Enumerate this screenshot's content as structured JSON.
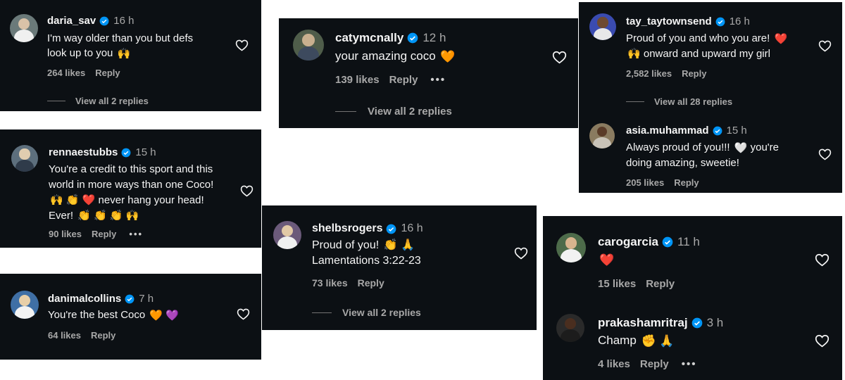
{
  "colors": {
    "card_bg": "#0c1014",
    "verified": "#0095f6",
    "muted": "#a8a8a8",
    "heart_red": "#ff3040",
    "heart_orange": "#ff7a45",
    "heart_purple": "#a855f7",
    "heart_lilac": "#d8c8f5"
  },
  "comments": [
    {
      "user": "daria_sav",
      "time": "16 h",
      "lines": [
        "I'm way older than you but defs",
        "look up to you"
      ],
      "line_emojis": [
        "",
        "🙌"
      ],
      "likes": "264 likes",
      "reply": "Reply",
      "view_replies": "View all 2 replies"
    },
    {
      "user": "catymcnally",
      "time": "12 h",
      "lines": [
        "your amazing coco"
      ],
      "line_emojis": [
        "🧡"
      ],
      "likes": "139 likes",
      "reply": "Reply",
      "more": "•••",
      "view_replies": "View all 2 replies"
    },
    {
      "user": "tay_taytownsend",
      "time": "16 h",
      "lines": [
        "Proud of you and who you are!",
        "onward and upward my girl"
      ],
      "line_emojis": [
        "❤️",
        "🙌"
      ],
      "likes": "2,582 likes",
      "reply": "Reply",
      "view_replies": "View all 28 replies"
    },
    {
      "user": "asia.muhammad",
      "time": "15 h",
      "lines": [
        "Always proud of you!!!",
        "doing amazing, sweetie!"
      ],
      "mid_emoji": "🤍",
      "mid_text": "you're",
      "likes": "205 likes",
      "reply": "Reply"
    },
    {
      "user": "rennaestubbs",
      "time": "15 h",
      "lines": [
        "You're a credit to this sport and this",
        "world in more ways than one Coco!",
        "never hang your head!",
        "Ever!"
      ],
      "line3_emojis": "🙌 👏 ❤️",
      "line4_emojis": "👏 👏 👏 🙌",
      "likes": "90 likes",
      "reply": "Reply",
      "more": "•••"
    },
    {
      "user": "shelbsrogers",
      "time": "16 h",
      "lines": [
        "Proud of you!",
        "Lamentations 3:22-23"
      ],
      "line_emojis": [
        "👏 🙏",
        ""
      ],
      "likes": "73 likes",
      "reply": "Reply",
      "view_replies": "View all 2 replies"
    },
    {
      "user": "carogarcia",
      "time": "11 h",
      "lines": [
        "❤️"
      ],
      "likes": "15 likes",
      "reply": "Reply"
    },
    {
      "user": "danimalcollins",
      "time": "7 h",
      "lines": [
        "You're the best Coco"
      ],
      "line_emojis": [
        "🧡 💜"
      ],
      "likes": "64 likes",
      "reply": "Reply"
    },
    {
      "user": "prakashamritraj",
      "time": "3 h",
      "lines": [
        "Champ"
      ],
      "line_emojis": [
        "✊ 🙏"
      ],
      "likes": "4 likes",
      "reply": "Reply",
      "more": "•••"
    }
  ],
  "icons": {
    "verified": "verified-badge-icon",
    "heart": "heart-outline-icon",
    "more": "more-dots-icon"
  }
}
